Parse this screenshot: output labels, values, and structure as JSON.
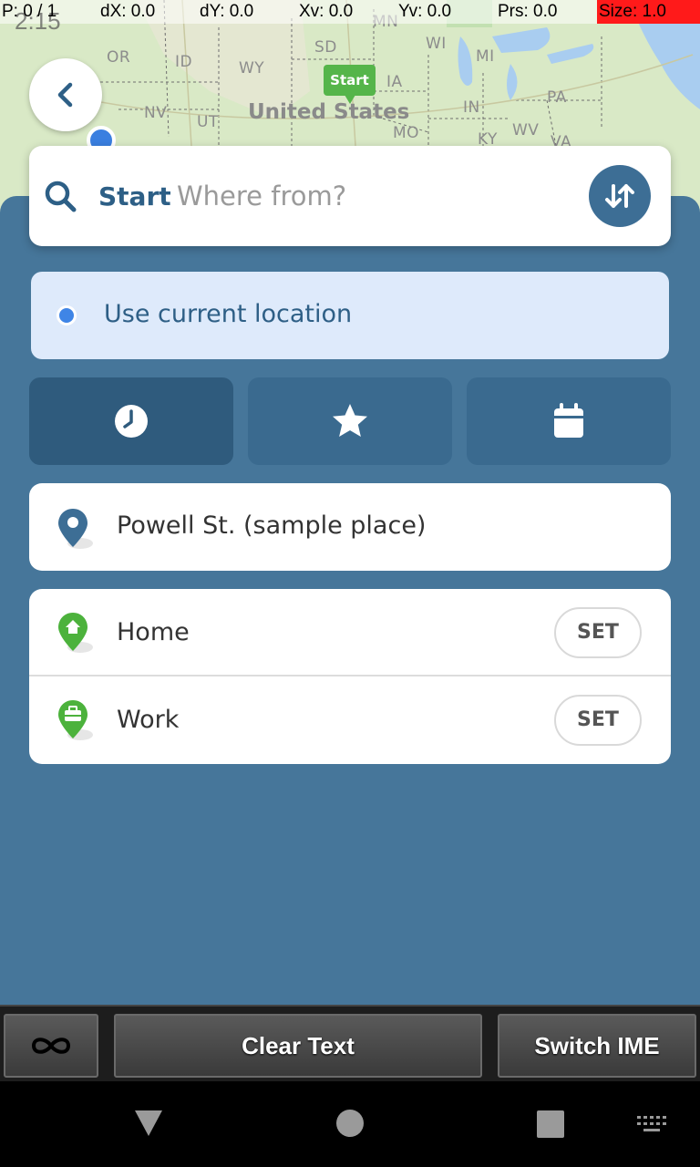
{
  "overlay": {
    "clock": "2:15",
    "pointer": "P: 0 / 1",
    "dx": "dX: 0.0",
    "dy": "dY: 0.0",
    "xv": "Xv: 0.0",
    "yv": "Yv: 0.0",
    "prs": "Prs: 0.0",
    "size": "Size: 1.0"
  },
  "map": {
    "country": "United States",
    "start_marker": "Start",
    "state_labels": [
      "OR",
      "ID",
      "WY",
      "SD",
      "MN",
      "WI",
      "MI",
      "IA",
      "NV",
      "UT",
      "IN",
      "PA",
      "MO",
      "KY",
      "WV",
      "VA"
    ]
  },
  "search": {
    "label": "Start",
    "placeholder": "Where from?"
  },
  "current_location": {
    "label": "Use current location"
  },
  "tabs": [
    {
      "icon": "clock-icon",
      "active": true
    },
    {
      "icon": "star-icon",
      "active": false
    },
    {
      "icon": "calendar-icon",
      "active": false
    }
  ],
  "recent": {
    "place": "Powell St. (sample place)"
  },
  "saved": {
    "home_label": "Home",
    "work_label": "Work",
    "set_label": "SET"
  },
  "keyboard_bar": {
    "infinity_icon": "infinity-icon",
    "clear_text": "Clear Text",
    "switch_ime": "Switch IME"
  },
  "colors": {
    "panel": "#46769a",
    "accent": "#2d5f86",
    "pin_blue": "#3d6e95",
    "pin_green": "#4cb23c",
    "current_location_bg": "#deeafb"
  }
}
